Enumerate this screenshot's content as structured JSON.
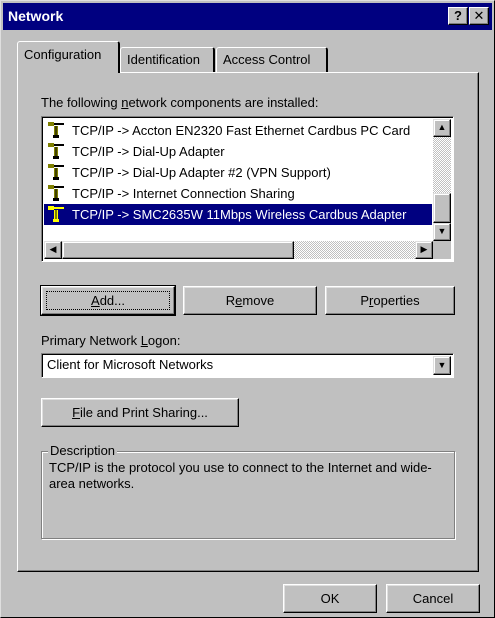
{
  "window": {
    "title": "Network",
    "help_button": "?",
    "close_button": "✕"
  },
  "tabs": [
    {
      "label": "Configuration",
      "active": true
    },
    {
      "label": "Identification",
      "active": false
    },
    {
      "label": "Access Control",
      "active": false
    }
  ],
  "components": {
    "label_pre": "The following ",
    "label_accel": "n",
    "label_post": "etwork components are installed:",
    "items": [
      {
        "icon": "network-protocol-icon",
        "text": "TCP/IP -> Accton EN2320 Fast Ethernet Cardbus PC Card",
        "selected": false
      },
      {
        "icon": "network-protocol-icon",
        "text": "TCP/IP -> Dial-Up Adapter",
        "selected": false
      },
      {
        "icon": "network-protocol-icon",
        "text": "TCP/IP -> Dial-Up Adapter #2 (VPN Support)",
        "selected": false
      },
      {
        "icon": "network-protocol-icon",
        "text": "TCP/IP -> Internet Connection Sharing",
        "selected": false
      },
      {
        "icon": "network-protocol-icon",
        "text": "TCP/IP -> SMC2635W 11Mbps Wireless Cardbus Adapter",
        "selected": true
      }
    ]
  },
  "buttons": {
    "add": {
      "accel": "A",
      "rest": "dd..."
    },
    "remove": {
      "pre": "R",
      "accel": "e",
      "rest": "move"
    },
    "properties": {
      "pre": "P",
      "accel": "r",
      "rest": "operties"
    }
  },
  "logon": {
    "label_pre": "Primary Network ",
    "label_accel": "L",
    "label_post": "ogon:",
    "value": "Client for Microsoft Networks"
  },
  "file_sharing": {
    "accel": "F",
    "rest": "ile and Print Sharing..."
  },
  "description": {
    "legend": "Description",
    "text": "TCP/IP is the protocol you use to connect to the Internet and wide-area networks."
  },
  "footer": {
    "ok": "OK",
    "cancel": "Cancel"
  }
}
